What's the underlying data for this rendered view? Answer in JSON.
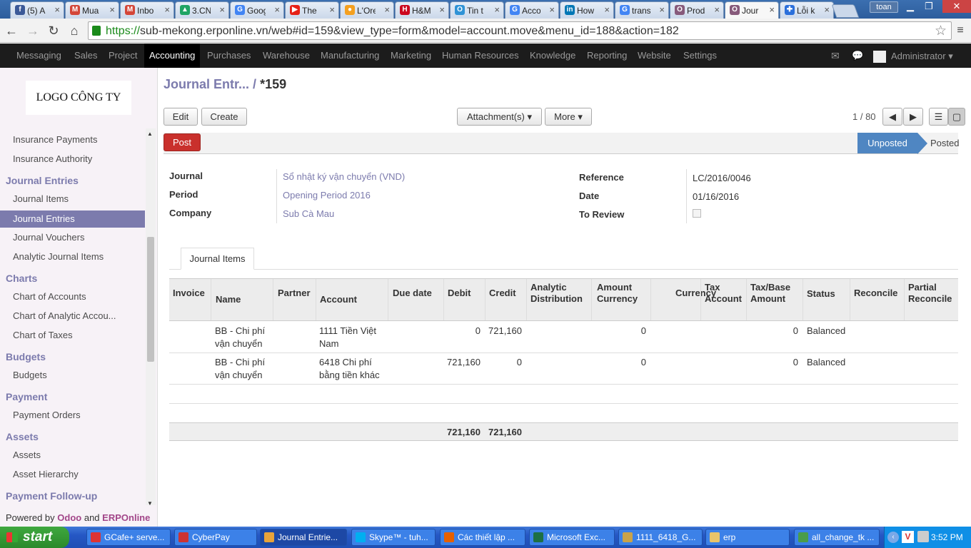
{
  "browser": {
    "tabs": [
      {
        "label": "(5) A",
        "fav": "f",
        "color": "#3b5998"
      },
      {
        "label": "Mua",
        "fav": "M",
        "color": "#d44638"
      },
      {
        "label": "Inbo",
        "fav": "M",
        "color": "#d44638"
      },
      {
        "label": "3.CN",
        "fav": "▲",
        "color": "#1fa463"
      },
      {
        "label": "Goog",
        "fav": "G",
        "color": "#4285f4"
      },
      {
        "label": "The",
        "fav": "▶",
        "color": "#e62117"
      },
      {
        "label": "L'Ore",
        "fav": "●",
        "color": "#f4a020"
      },
      {
        "label": "H&M",
        "fav": "H",
        "color": "#cc071e"
      },
      {
        "label": "Tin t",
        "fav": "O",
        "color": "#2f93d6"
      },
      {
        "label": "Acco",
        "fav": "G",
        "color": "#4285f4"
      },
      {
        "label": "How",
        "fav": "in",
        "color": "#0077b5"
      },
      {
        "label": "trans",
        "fav": "G",
        "color": "#4285f4"
      },
      {
        "label": "Prod",
        "fav": "O",
        "color": "#875a7b"
      },
      {
        "label": "Jour",
        "fav": "O",
        "color": "#875a7b"
      },
      {
        "label": "Lỗi k",
        "fav": "✚",
        "color": "#2a6fdb"
      }
    ],
    "active_tab": 13,
    "user": "toan",
    "url_secure": "https://",
    "url_host": "sub-mekong.erponline.vn",
    "url_rest": "/web#id=159&view_type=form&model=account.move&menu_id=188&action=182"
  },
  "topmenu": {
    "items": [
      "Messaging",
      "Sales",
      "Project",
      "Accounting",
      "Purchases",
      "Warehouse",
      "Manufacturing",
      "Marketing",
      "Human Resources",
      "Knowledge",
      "Reporting",
      "Website",
      "Settings"
    ],
    "active": 3,
    "user": "Administrator"
  },
  "sidebar": {
    "logo": "LOGO CÔNG TY",
    "entries": [
      {
        "type": "item",
        "label": "Insurance Payments"
      },
      {
        "type": "item",
        "label": "Insurance Authority"
      },
      {
        "type": "section",
        "label": "Journal Entries"
      },
      {
        "type": "item",
        "label": "Journal Items"
      },
      {
        "type": "item",
        "label": "Journal Entries",
        "active": true
      },
      {
        "type": "item",
        "label": "Journal Vouchers"
      },
      {
        "type": "item",
        "label": "Analytic Journal Items"
      },
      {
        "type": "section",
        "label": "Charts"
      },
      {
        "type": "item",
        "label": "Chart of Accounts"
      },
      {
        "type": "item",
        "label": "Chart of Analytic Accou..."
      },
      {
        "type": "item",
        "label": "Chart of Taxes"
      },
      {
        "type": "section",
        "label": "Budgets"
      },
      {
        "type": "item",
        "label": "Budgets"
      },
      {
        "type": "section",
        "label": "Payment"
      },
      {
        "type": "item",
        "label": "Payment Orders"
      },
      {
        "type": "section",
        "label": "Assets"
      },
      {
        "type": "item",
        "label": "Assets"
      },
      {
        "type": "item",
        "label": "Asset Hierarchy"
      },
      {
        "type": "section",
        "label": "Payment Follow-up"
      }
    ],
    "powered_prefix": "Powered by",
    "powered_odoo": "Odoo",
    "powered_and": "and",
    "powered_erp": "ERPOnline"
  },
  "breadcrumb": {
    "parent": "Journal Entr...",
    "sep": "/",
    "current": "*159"
  },
  "buttons": {
    "edit": "Edit",
    "create": "Create",
    "attachment": "Attachment(s) ▾",
    "more": "More ▾",
    "post": "Post"
  },
  "pager": "1 / 80",
  "status": {
    "unposted": "Unposted",
    "posted": "Posted"
  },
  "form": {
    "journal_label": "Journal",
    "journal": "Sổ nhật ký vận chuyển (VND)",
    "period_label": "Period",
    "period": "Opening Period 2016",
    "company_label": "Company",
    "company": "Sub Cà Mau",
    "reference_label": "Reference",
    "reference": "LC/2016/0046",
    "date_label": "Date",
    "date": "01/16/2016",
    "review_label": "To Review"
  },
  "notebook_tab": "Journal Items",
  "table": {
    "headers": [
      "Invoice",
      "Name",
      "Partner",
      "Account",
      "Due date",
      "Debit",
      "Credit",
      "Analytic Distribution",
      "Amount Currency",
      "Currency",
      "Tax Account",
      "Tax/Base Amount",
      "Status",
      "Reconcile",
      "Partial Reconcile"
    ],
    "rows": [
      {
        "name": "BB - Chi phí vận chuyển",
        "account": "1111 Tiền Việt Nam",
        "debit": "0",
        "credit": "721,160",
        "amount_currency": "0",
        "tax_base": "0",
        "status": "Balanced"
      },
      {
        "name": "BB - Chi phí vận chuyển",
        "account": "6418 Chi phí bằng tiền khác",
        "debit": "721,160",
        "credit": "0",
        "amount_currency": "0",
        "tax_base": "0",
        "status": "Balanced"
      }
    ],
    "total_debit": "721,160",
    "total_credit": "721,160"
  },
  "taskbar": {
    "start": "start",
    "items": [
      {
        "label": "GCafe+ serve...",
        "color": "#d33"
      },
      {
        "label": "CyberPay",
        "color": "#c33"
      },
      {
        "label": "Journal Entrie...",
        "color": "#e8a33a",
        "active": true
      },
      {
        "label": "Skype™ - tuh...",
        "color": "#00aff0"
      },
      {
        "label": "Các thiết lập ...",
        "color": "#e66000"
      },
      {
        "label": "Microsoft Exc...",
        "color": "#1d7044"
      },
      {
        "label": "1111_6418_G...",
        "color": "#c9a34a"
      },
      {
        "label": "erp",
        "color": "#e9c46a"
      },
      {
        "label": "all_change_tk ...",
        "color": "#4a9c4a"
      }
    ],
    "clock": "3:52 PM"
  }
}
